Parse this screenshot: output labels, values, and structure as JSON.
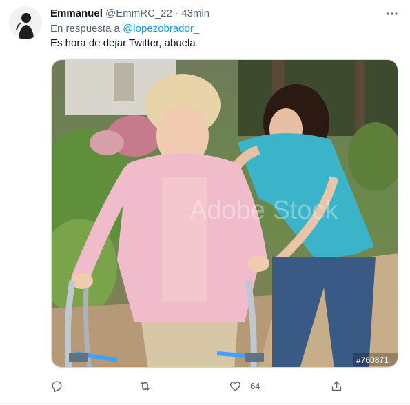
{
  "tweet": {
    "author_name": "Emmanuel",
    "author_handle": "@EmmRC_22",
    "separator": "·",
    "time": "43min",
    "reply_prefix": "En respuesta a",
    "reply_mention": "@lopezobrador_",
    "text": "Es hora de dejar Twitter, abuela",
    "media": {
      "watermark_text": "Adobe Stock",
      "watermark_id": "#760871"
    },
    "actions": {
      "reply_count": "",
      "retweet_count": "",
      "like_count": "64",
      "share_count": ""
    }
  },
  "colors": {
    "accent": "#1d9bf0",
    "secondary_text": "#536471",
    "primary_text": "#0f1419"
  },
  "icons": [
    "avatar",
    "more-icon",
    "reply-icon",
    "retweet-icon",
    "like-icon",
    "share-icon"
  ]
}
